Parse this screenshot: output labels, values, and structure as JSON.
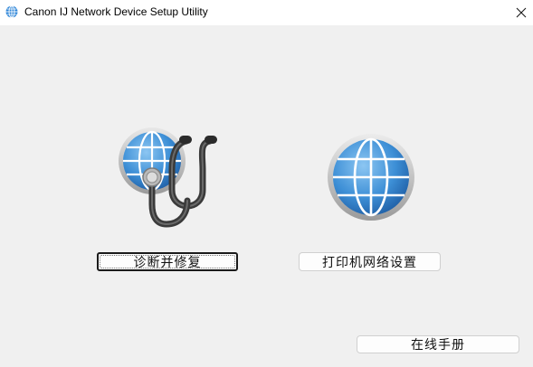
{
  "window": {
    "title": "Canon IJ Network Device Setup Utility"
  },
  "icons": {
    "app": "globe-icon",
    "close": "close-icon",
    "diagnose": "stethoscope-globe-icon",
    "network": "globe-icon"
  },
  "main": {
    "diagnose_button_label": "诊断并修复",
    "network_settings_button_label": "打印机网络设置",
    "online_manual_button_label": "在线手册"
  },
  "colors": {
    "globe_blue": "#3d8fd6",
    "background": "#f0f0f0"
  }
}
